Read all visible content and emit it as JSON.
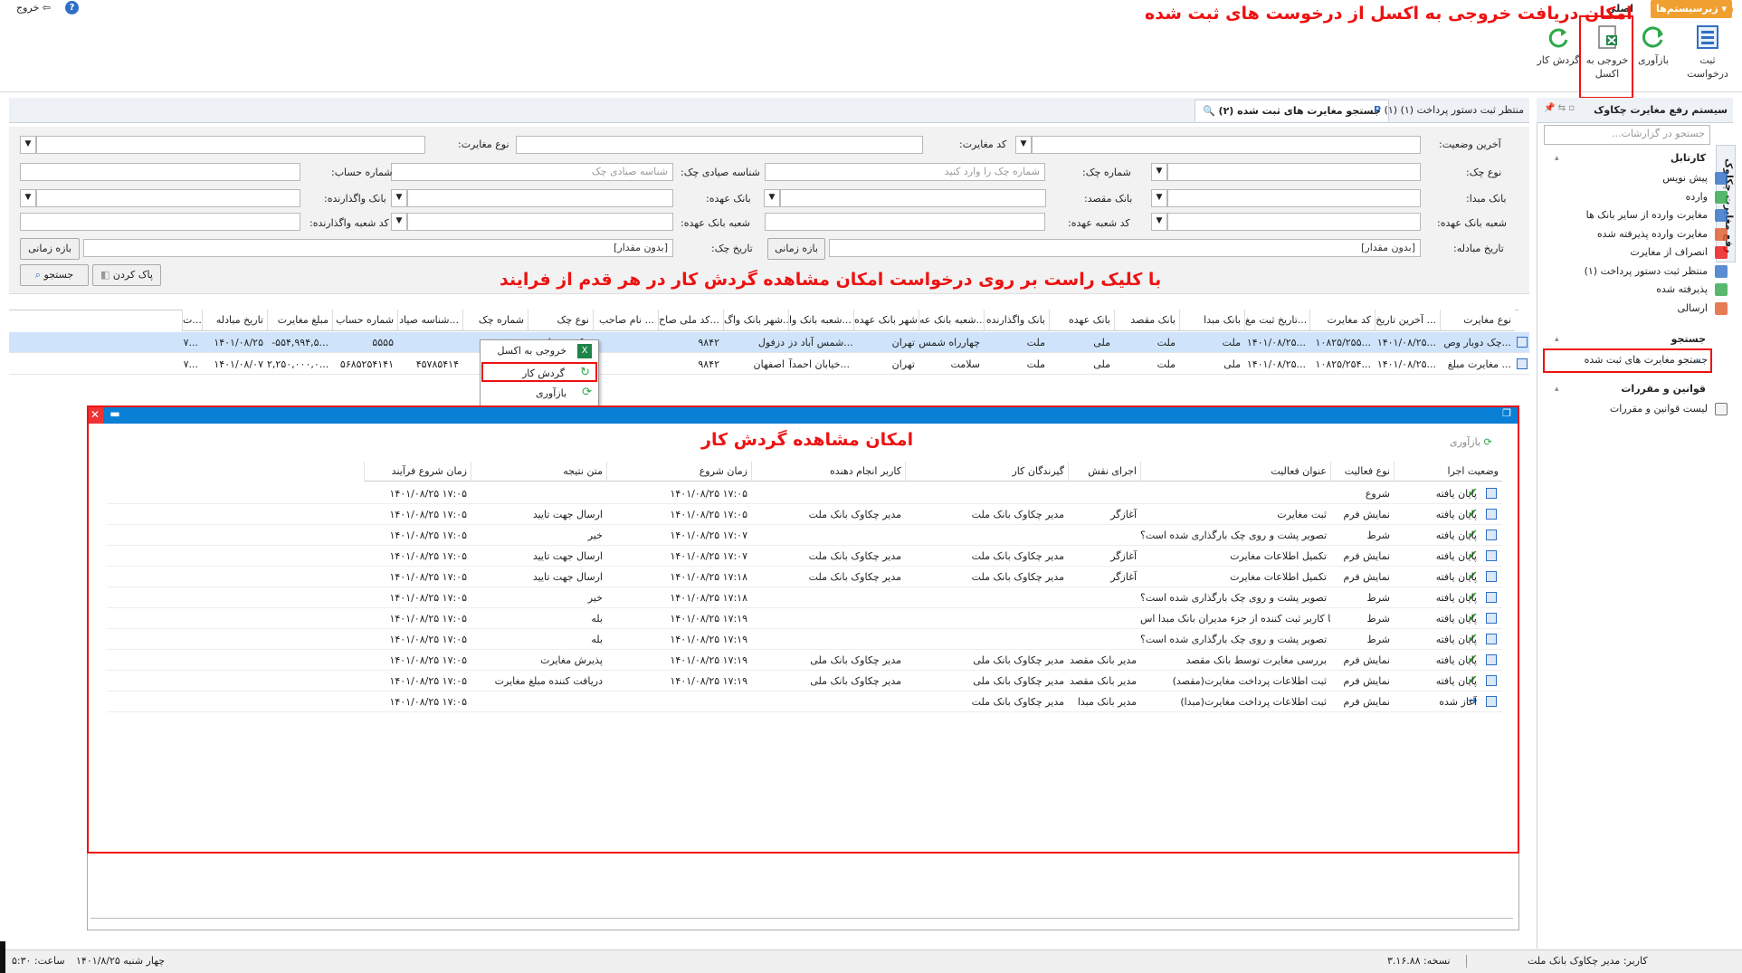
{
  "topbar": {
    "exit_label": "خروج",
    "subsystems_label": "زیرسیستم‌ها",
    "main_label": "اصلی"
  },
  "ribbon": {
    "register_request": "ثبت درخواست",
    "refresh": "بازآوری",
    "export_excel": "خروجی به اکسل",
    "workflow": "گردش کار"
  },
  "annotations": {
    "excel_note": "امکان دریافت خروجی به اکسل از درخوست های ثبت شده",
    "context_note": "با کلیک راست بر روی درخواست امکان مشاهده گردش کار در هر قدم از فرایند",
    "workflow_note": "امکان مشاهده گردش کار"
  },
  "tabs": {
    "search_tab": "جستجو مغایرت های ثبت شده (۲)",
    "pending_tab": "منتظر ثبت دستور پرداخت (۱) (۱)"
  },
  "filters": {
    "last_status": "آخرین وضعیت:",
    "discrepancy_code": "کد مغایرت:",
    "discrepancy_type": "نوع مغایرت:",
    "check_type": "نوع چک:",
    "check_number": "شماره چک:",
    "check_number_ph": "شماره چک را وارد کنید",
    "sayad_id": "شناسه صیادی چک:",
    "sayad_id_ph": "شناسه صیادی چک",
    "account_number": "شماره حساب:",
    "origin_bank": "بانک مبدا:",
    "dest_bank": "بانک مقصد:",
    "custody_bank": "بانک عهده:",
    "assigner_bank": "بانک واگذارنده:",
    "custody_branch": "شعبه بانک عهده:",
    "custody_branch_code": "کد شعبه عهده:",
    "assigner_branch_code": "کد شعبه واگذارنده:",
    "exchange_date": "تاریخ مبادله:",
    "check_date": "تاریخ چک:",
    "no_value": "[بدون مقدار]",
    "range": "بازه زمانی",
    "clear": "پاک کردن",
    "search": "جستجو"
  },
  "grid": {
    "columns": [
      "نوع مغایرت",
      "آخرین تاریخ ...",
      "کد مغایرت",
      "تاریخ ثبت مغ...",
      "بانک مبدا",
      "بانک مقصد",
      "بانک عهده",
      "بانک واگذارنده",
      "شعبه بانک عه...",
      "شهر بانک عهده",
      "شعبه بانک وا...",
      "شهر بانک واگ...",
      "کد ملی صاح...",
      "نام صاحب ...",
      "نوع چک",
      "شماره چک",
      "شناسه صیاد...",
      "شماره حساب",
      "مبلغ مغایرت",
      "تاریخ مبادله",
      "ت..."
    ],
    "rows": [
      [
        "چک دوبار وص...",
        "۱۴۰۱/۰۸/۲۵...",
        "۱۰۸۲۵/۲۵۵...",
        "۱۴۰۱/۰۸/۲۵...",
        "ملت",
        "ملت",
        "ملی",
        "ملت",
        "چهارراه شمس",
        "تهران",
        "شمس آباد دز...",
        "دزفول",
        "۹۸۴۲",
        "",
        "چک رمزدار",
        "۵۵۵۵۵۵",
        "",
        "۵۵۵۵",
        "-۵۵۴,۹۹۴,۵...",
        "۱۴۰۱/۰۸/۲۵",
        "۷..."
      ],
      [
        "مغایرت مبلغ ...",
        "۱۴۰۱/۰۸/۲۵...",
        "۱۰۸۲۵/۲۵۴...",
        "۱۴۰۱/۰۸/۲۵...",
        "ملی",
        "ملت",
        "ملی",
        "ملت",
        "سلامت",
        "تهران",
        "خیابان احمدآ...",
        "اصفهان",
        "۹۸۴۲",
        "",
        "چک عادی",
        "",
        "۴۵۷۸۵۴۱۴",
        "۵۶۸۵۲۵۴۱۴۱",
        "۲,۲۵۰,۰۰۰,۰...",
        "۱۴۰۱/۰۸/۰۷",
        "۷..."
      ]
    ]
  },
  "context_menu": {
    "export": "خروجی به اکسل",
    "workflow": "گردش کار",
    "refresh": "بازآوری"
  },
  "sidebar": {
    "title": "سیستم رفع مغایرت چکاوک",
    "search_ph": "جستجو در گزارشات...",
    "vertical_tab": "رفع مغایرت چکاوک",
    "group_inbox": "کارتابل",
    "inbox_items": [
      "پیش نویس",
      "وارده",
      "مغایرت وارده از سایر بانک ها",
      "مغایرت وارده پذیرفته شده",
      "انصراف از مغایرت",
      "منتظر ثبت دستور پرداخت (۱)",
      "پذیرفته شده",
      "ارسالی"
    ],
    "group_search": "جستجو",
    "search_item": "جستجو مغایرت های ثبت شده",
    "group_rules": "قوانین و مقررات",
    "rules_item": "لیست قوانین و مقررات"
  },
  "workflow_window": {
    "refresh": "بازآوری",
    "columns": [
      "وضعیت اجرا",
      "نوع فعالیت",
      "عنوان فعالیت",
      "اجرای نقش",
      "گیرندگان کار",
      "کاربر انجام دهنده",
      "زمان شروع",
      "متن نتیجه",
      "زمان شروع فرآیند"
    ],
    "rows": [
      [
        "پایان یافته",
        "شروع",
        "",
        "",
        "",
        "",
        "۱۴۰۱/۰۸/۲۵ ۱۷:۰۵",
        "",
        "۱۴۰۱/۰۸/۲۵ ۱۷:۰۵"
      ],
      [
        "پایان یافته",
        "نمایش فرم",
        "ثبت مغایرت",
        "آغازگر",
        "مدیر چکاوک بانک ملت",
        "مدیر چکاوک بانک ملت",
        "۱۴۰۱/۰۸/۲۵ ۱۷:۰۵",
        "ارسال جهت تایید",
        "۱۴۰۱/۰۸/۲۵ ۱۷:۰۵"
      ],
      [
        "پایان یافته",
        "شرط",
        "آیا تصویر پشت و روی چک بارگذاری شده است؟",
        "",
        "",
        "",
        "۱۴۰۱/۰۸/۲۵ ۱۷:۰۷",
        "خیر",
        "۱۴۰۱/۰۸/۲۵ ۱۷:۰۵"
      ],
      [
        "پایان یافته",
        "نمایش فرم",
        "تکمیل اطلاعات مغایرت",
        "آغازگر",
        "مدیر چکاوک بانک ملت",
        "مدیر چکاوک بانک ملت",
        "۱۴۰۱/۰۸/۲۵ ۱۷:۰۷",
        "ارسال جهت تایید",
        "۱۴۰۱/۰۸/۲۵ ۱۷:۰۵"
      ],
      [
        "پایان یافته",
        "نمایش فرم",
        "تکمیل اطلاعات مغایرت",
        "آغازگر",
        "مدیر چکاوک بانک ملت",
        "مدیر چکاوک بانک ملت",
        "۱۴۰۱/۰۸/۲۵ ۱۷:۱۸",
        "ارسال جهت تایید",
        "۱۴۰۱/۰۸/۲۵ ۱۷:۰۵"
      ],
      [
        "پایان یافته",
        "شرط",
        "آیا تصویر پشت و روی چک بارگذاری شده است؟",
        "",
        "",
        "",
        "۱۴۰۱/۰۸/۲۵ ۱۷:۱۸",
        "خیر",
        "۱۴۰۱/۰۸/۲۵ ۱۷:۰۵"
      ],
      [
        "پایان یافته",
        "شرط",
        "ایا کاربر ثبت کننده از جزء مدیران بانک مبدا اس...",
        "",
        "",
        "",
        "۱۴۰۱/۰۸/۲۵ ۱۷:۱۹",
        "بله",
        "۱۴۰۱/۰۸/۲۵ ۱۷:۰۵"
      ],
      [
        "پایان یافته",
        "شرط",
        "آیا تصویر پشت و روی چک بارگذاری شده است؟",
        "",
        "",
        "",
        "۱۴۰۱/۰۸/۲۵ ۱۷:۱۹",
        "بله",
        "۱۴۰۱/۰۸/۲۵ ۱۷:۰۵"
      ],
      [
        "پایان یافته",
        "نمایش فرم",
        "بررسی مغایرت توسط بانک مقصد",
        "مدیر بانک مقصد",
        "مدیر چکاوک بانک ملی",
        "مدیر چکاوک بانک ملی",
        "۱۴۰۱/۰۸/۲۵ ۱۷:۱۹",
        "پذیرش مغایرت",
        "۱۴۰۱/۰۸/۲۵ ۱۷:۰۵"
      ],
      [
        "پایان یافته",
        "نمایش فرم",
        "ثبت اطلاعات پرداخت مغایرت(مقصد)",
        "مدیر بانک مقصد",
        "مدیر چکاوک بانک ملی",
        "مدیر چکاوک بانک ملی",
        "۱۴۰۱/۰۸/۲۵ ۱۷:۱۹",
        "دریافت کننده مبلغ مغایرت",
        "۱۴۰۱/۰۸/۲۵ ۱۷:۰۵"
      ],
      [
        "آغاز شده",
        "نمایش فرم",
        "ثبت اطلاعات پرداخت مغایرت(مبدا)",
        "مدیر بانک مبدا",
        "مدیر چکاوک بانک ملت",
        "",
        "",
        "",
        "۱۴۰۱/۰۸/۲۵ ۱۷:۰۵"
      ]
    ]
  },
  "status": {
    "user": "کاربر: مدیر چکاوک بانک ملت",
    "version": "نسخه: ۳.۱۶.۸۸",
    "date": "چهار شنبه ۱۴۰۱/۸/۲۵",
    "time": "ساعت: ۵:۳۰"
  },
  "colors": {
    "accent": "#0a7fd6",
    "annotation": "#e11111",
    "orange": "#f0a030",
    "ok_green": "#2a9d2a"
  }
}
